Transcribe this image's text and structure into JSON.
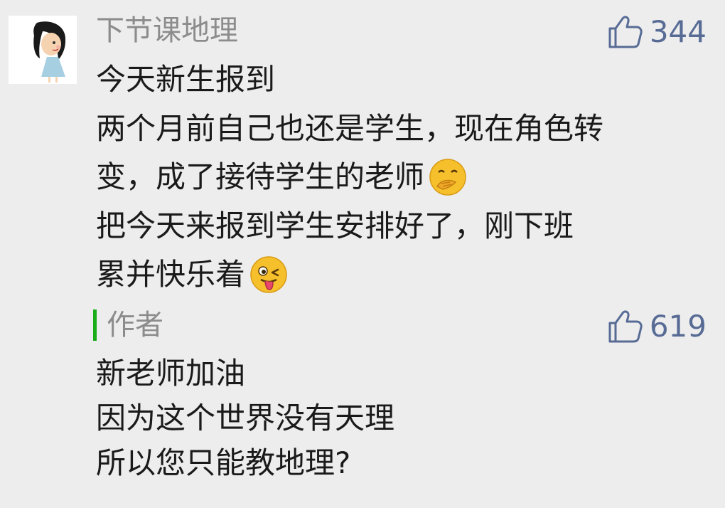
{
  "comment": {
    "username": "下节课地理",
    "like_count": "344",
    "lines": [
      "今天新生报到",
      "两个月前自己也还是学生，现在角色转",
      "变，成了接待学生的老师",
      "把今天来报到学生安排好了，刚下班",
      "累并快乐着"
    ],
    "emojis": [
      "smirk-hand-over-mouth-emoji",
      "winking-tongue-out-emoji"
    ]
  },
  "reply": {
    "author_label": "作者",
    "like_count": "619",
    "lines": [
      "新老师加油",
      "因为这个世界没有天理",
      "所以您只能教地理?"
    ]
  },
  "colors": {
    "background": "#ededed",
    "username": "#8c8c8c",
    "like": "#576b95",
    "author_bar": "#1aad19",
    "text": "#1a1a1a"
  },
  "icons": {
    "like": "thumbs-up-outline-icon",
    "avatar": "cartoon-girl-avatar"
  }
}
